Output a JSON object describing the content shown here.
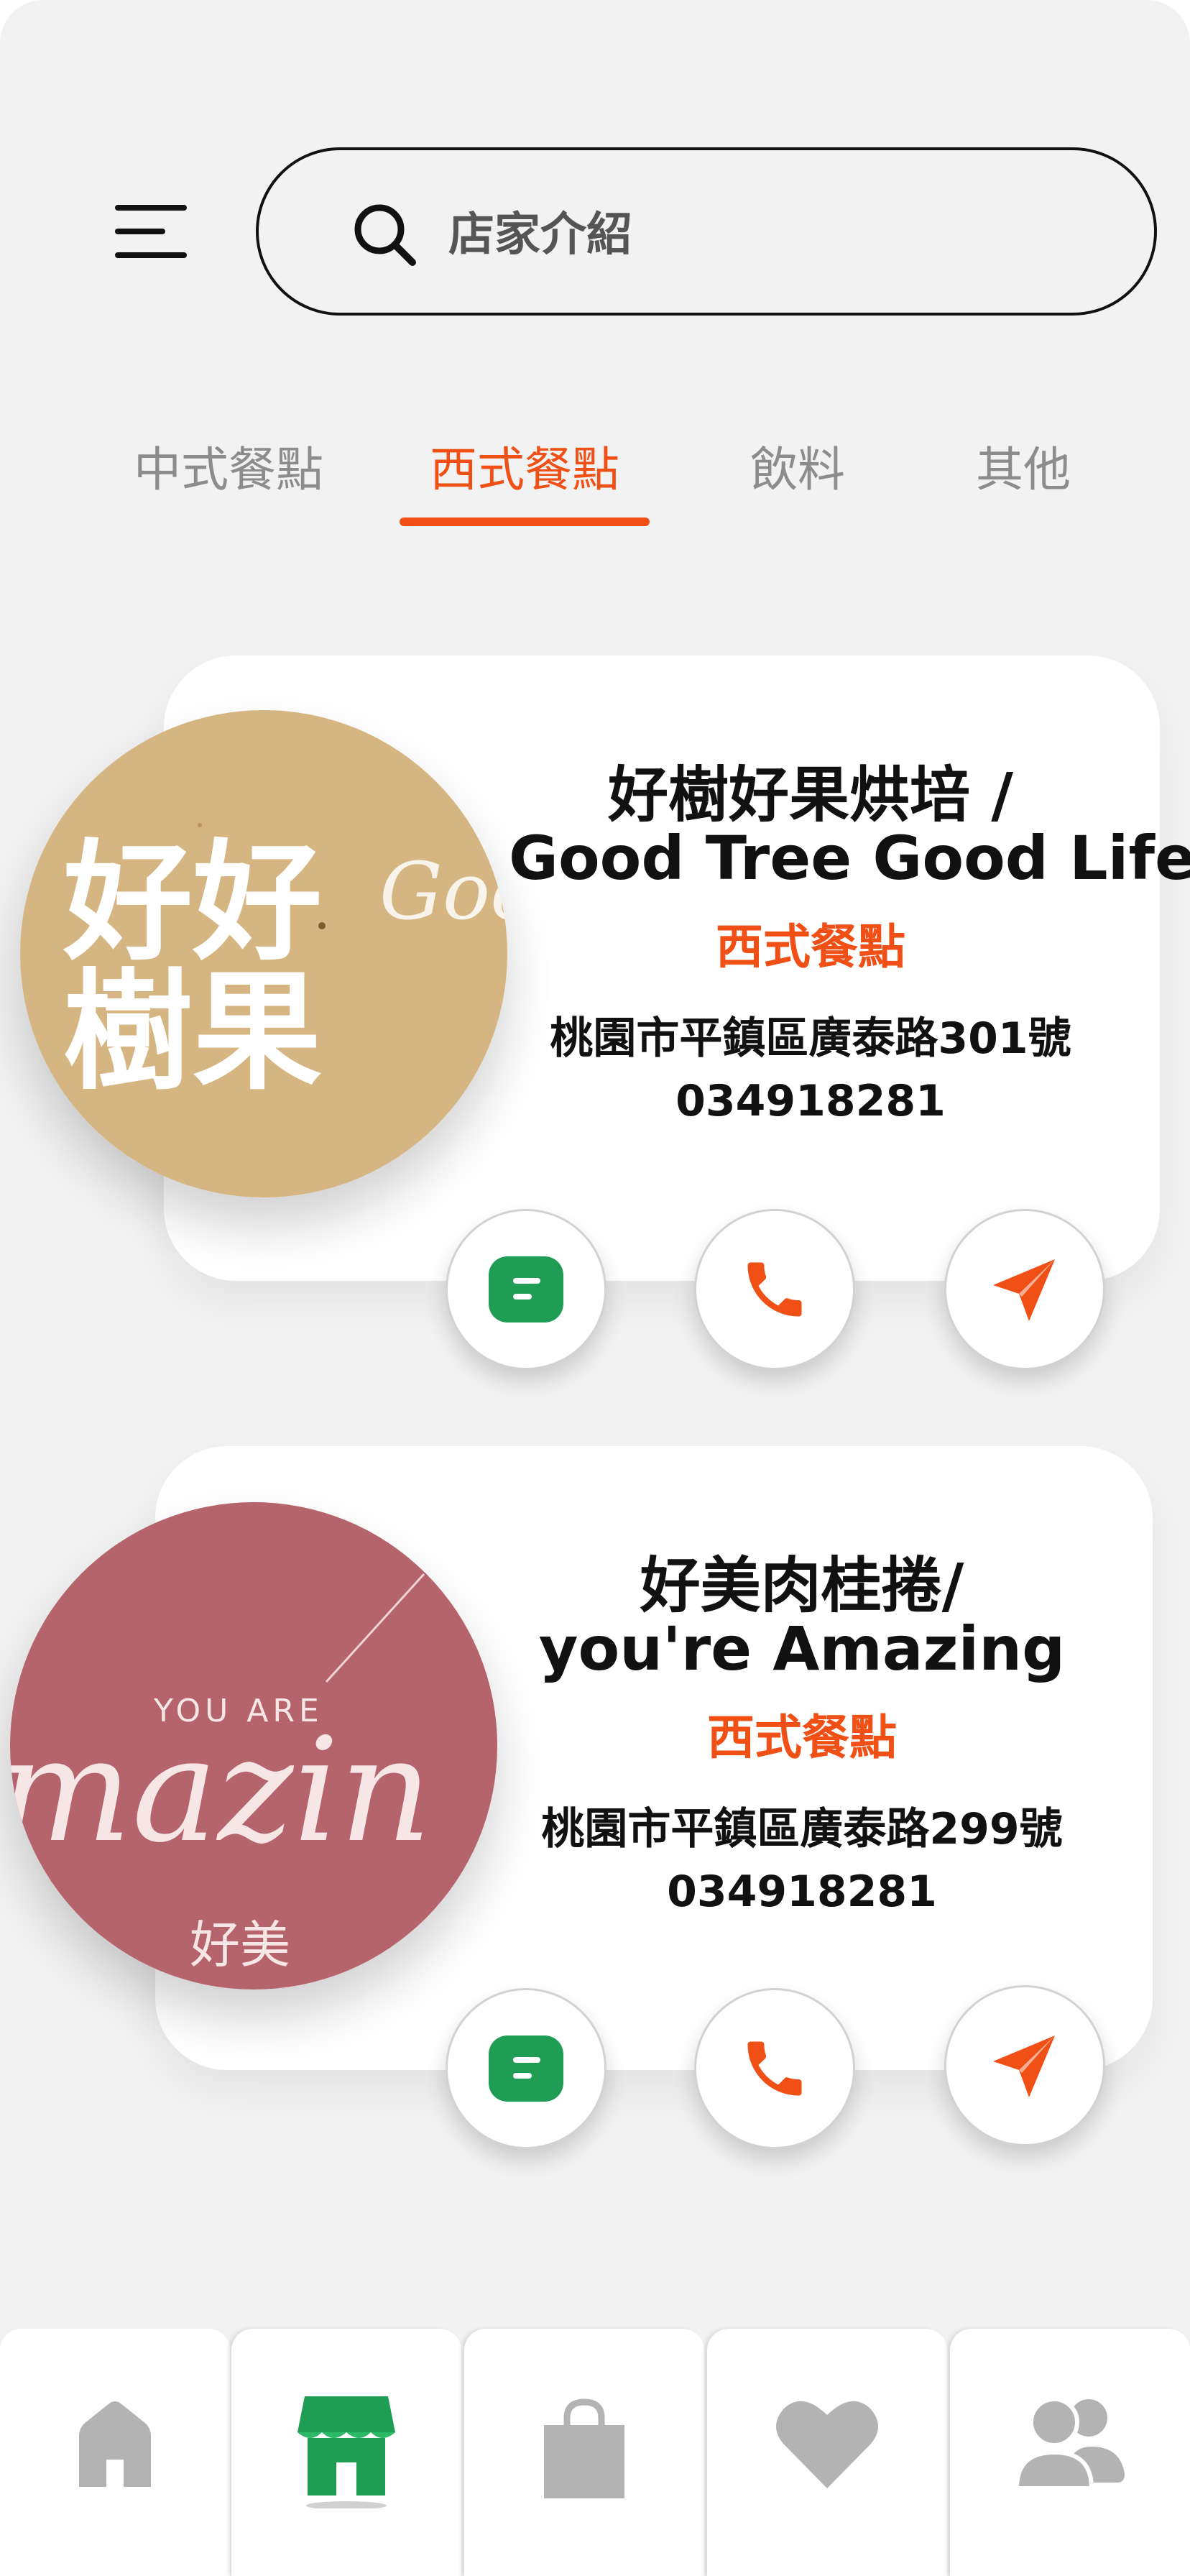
{
  "search": {
    "placeholder": "店家介紹"
  },
  "tabs": [
    {
      "label": "中式餐點",
      "active": false
    },
    {
      "label": "西式餐點",
      "active": true
    },
    {
      "label": "飲料",
      "active": false
    },
    {
      "label": "其他",
      "active": false
    }
  ],
  "shops": [
    {
      "name_line1": "好樹好果烘培 /",
      "name_line2": "Good Tree Good Life",
      "category": "西式餐點",
      "address": "桃園市平鎮區廣泰路301號",
      "phone": "034918281",
      "logo_text_cn_top": "好好",
      "logo_text_cn_bottom": "樹果",
      "logo_text_script": "Goo",
      "logo_color": "#d5b682"
    },
    {
      "name_line1": "好美肉桂捲/",
      "name_line2": "you're Amazing",
      "category": "西式餐點",
      "address": "桃園市平鎮區廣泰路299號",
      "phone": "034918281",
      "logo_text_top": "YOU ARE",
      "logo_text_script": "mazin",
      "logo_text_cn": "好美",
      "logo_color": "#b5646b"
    }
  ],
  "actions": [
    "message-icon",
    "phone-icon",
    "send-icon"
  ],
  "bottom_nav": [
    "home-icon",
    "store-icon",
    "shopping-bag-icon",
    "heart-icon",
    "users-icon"
  ],
  "colors": {
    "accent": "#f04f16",
    "green": "#1f9d55",
    "background": "#f2f2f2",
    "inactive": "#b3b3b3"
  }
}
